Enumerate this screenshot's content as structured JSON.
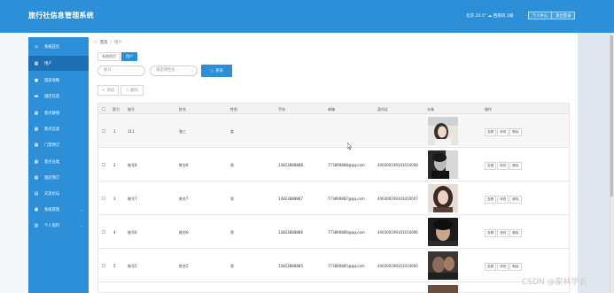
{
  "header": {
    "app_title": "旅行社信息管理系统",
    "weather": "北京  20.5°  ☁ 西南风  2级",
    "user_buttons": [
      "个人中心",
      "退出登录"
    ]
  },
  "sidebar": {
    "items": [
      {
        "label": "系统首页",
        "icon": "home-icon",
        "active": false,
        "expandable": false
      },
      {
        "label": "用户",
        "icon": "grid-icon",
        "active": true,
        "expandable": false
      },
      {
        "label": "旅游攻略",
        "icon": "bulb-icon",
        "active": false,
        "expandable": false
      },
      {
        "label": "酒店信息",
        "icon": "car-icon",
        "active": false,
        "expandable": false
      },
      {
        "label": "景点路线",
        "icon": "grid-icon",
        "active": false,
        "expandable": false
      },
      {
        "label": "景点信息",
        "icon": "grid-icon",
        "active": false,
        "expandable": false
      },
      {
        "label": "门票预订",
        "icon": "grid-icon",
        "active": false,
        "expandable": false
      },
      {
        "label": "景点分类",
        "icon": "grid-icon",
        "active": false,
        "expandable": false
      },
      {
        "label": "酒店预订",
        "icon": "grid-icon",
        "active": false,
        "expandable": false
      },
      {
        "label": "交流论坛",
        "icon": "forum-icon",
        "active": false,
        "expandable": false
      },
      {
        "label": "系统管理",
        "icon": "briefcase-icon",
        "active": false,
        "expandable": true
      },
      {
        "label": "个人资料",
        "icon": "calendar-icon",
        "active": false,
        "expandable": true
      }
    ]
  },
  "breadcrumb": {
    "home": "首页",
    "current": "用户"
  },
  "tabs": [
    "系统首页",
    "用户"
  ],
  "search": {
    "account_placeholder": "账号",
    "gender_placeholder": "请选择性别",
    "button_label": "查询"
  },
  "actions": {
    "add_label": "添加",
    "delete_label": "删除"
  },
  "table": {
    "headers": [
      "索引",
      "账号",
      "姓名",
      "性别",
      "手机",
      "邮箱",
      "身份证",
      "头像",
      "操作"
    ],
    "rows": [
      {
        "index": "1",
        "account": "111",
        "name": "张三",
        "gender": "女",
        "phone": "",
        "email": "",
        "id_card": ""
      },
      {
        "index": "2",
        "account": "账号8",
        "name": "姓名8",
        "gender": "男",
        "phone": "13823888888",
        "email": "773890888@qq.com",
        "id_card": "440300199101010008"
      },
      {
        "index": "3",
        "account": "账号7",
        "name": "姓名7",
        "gender": "男",
        "phone": "13823888887",
        "email": "773890887@qq.com",
        "id_card": "440300199101010007"
      },
      {
        "index": "4",
        "account": "账号6",
        "name": "姓名6",
        "gender": "男",
        "phone": "13823888886",
        "email": "773890886@qq.com",
        "id_card": "440300199101010006"
      },
      {
        "index": "5",
        "account": "账号5",
        "name": "姓名5",
        "gender": "男",
        "phone": "13823888885",
        "email": "773890885@qq.com",
        "id_card": "440300199101010005"
      }
    ],
    "row_ops": [
      "查看",
      "修改",
      "删除"
    ]
  },
  "watermark": "CSDN @家林学长",
  "colors": {
    "primary": "#2d8fd8",
    "sidebar_active": "#1f6fb2"
  }
}
